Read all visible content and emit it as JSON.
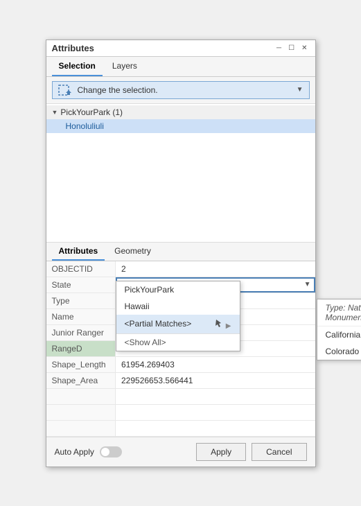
{
  "window": {
    "title": "Attributes",
    "controls": [
      "▾",
      "☐",
      "✕"
    ]
  },
  "tabs": [
    {
      "label": "Selection",
      "active": true
    },
    {
      "label": "Layers",
      "active": false
    }
  ],
  "toolbar": {
    "dropdown_label": "Change the selection.",
    "icon": "selection-icon"
  },
  "tree": {
    "parent_label": "PickYourPark (1)",
    "child_label": "Honoluliuli"
  },
  "bottom_tabs": [
    {
      "label": "Attributes",
      "active": true
    },
    {
      "label": "Geometry",
      "active": false
    }
  ],
  "attributes": [
    {
      "name": "OBJECTID",
      "value": "2"
    },
    {
      "name": "State",
      "value": "Hawaii",
      "editing": true
    },
    {
      "name": "Type",
      "value": ""
    },
    {
      "name": "Name",
      "value": ""
    },
    {
      "name": "Junior Ranger",
      "value": ""
    },
    {
      "name": "RangeD",
      "value": "",
      "highlight": true
    },
    {
      "name": "Shape_Length",
      "value": "61954.269403"
    },
    {
      "name": "Shape_Area",
      "value": "229526653.566441"
    }
  ],
  "dropdown": {
    "items": [
      {
        "label": "PickYourPark",
        "has_sub": false
      },
      {
        "label": "Hawaii",
        "has_sub": false
      },
      {
        "label": "<Partial Matches>",
        "has_sub": true
      },
      {
        "label": "<Show All>",
        "has_sub": false,
        "show_all": true
      }
    ]
  },
  "submenu": {
    "header": "Type: National Monument",
    "items": [
      {
        "label": "California"
      },
      {
        "label": "Colorado"
      }
    ]
  },
  "footer": {
    "auto_apply_label": "Auto Apply",
    "apply_label": "Apply",
    "cancel_label": "Cancel"
  }
}
